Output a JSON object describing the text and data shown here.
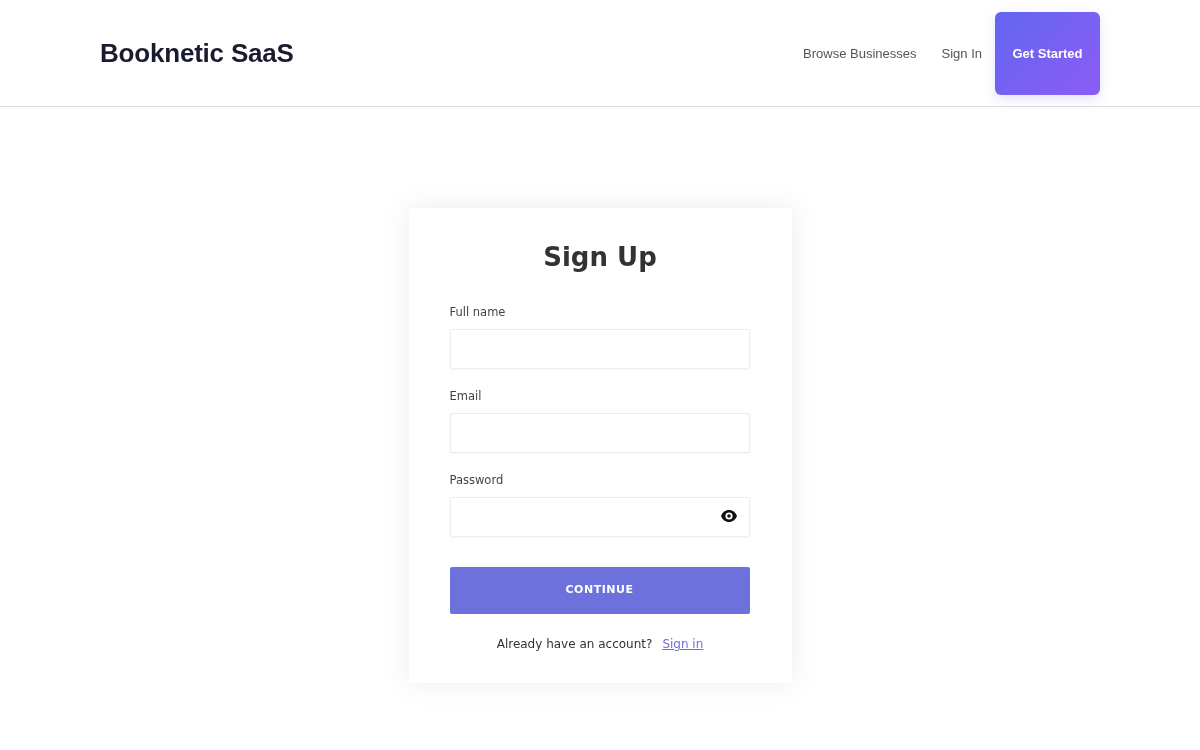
{
  "header": {
    "brand": "Booknetic SaaS",
    "nav_links": [
      "Browse Businesses",
      "Sign In"
    ],
    "cta_button": "Get Started"
  },
  "signup_form": {
    "title": "Sign Up",
    "fields": [
      {
        "label": "Full name",
        "kind": "text"
      },
      {
        "label": "Email",
        "kind": "text"
      },
      {
        "label": "Password",
        "kind": "password"
      }
    ],
    "submit_button": "CONTINUE",
    "footer": {
      "text": "Already have an account?",
      "link": "Sign in"
    }
  }
}
